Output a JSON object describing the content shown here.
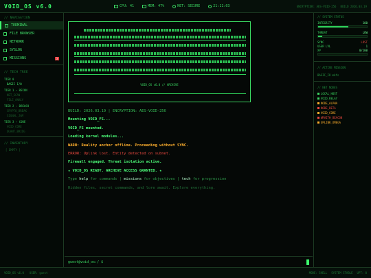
{
  "app": {
    "title": "VOID_OS v6.0"
  },
  "topbar": {
    "cpu": "CPU: 41",
    "mem": "MEM: 47%",
    "net": "NET: SECURE",
    "clock": "21:11:03",
    "right_a": "ENCRYPTION: AES-VOID-256",
    "right_b": "BUILD 2026.03.19"
  },
  "sidebar": {
    "nav_title": "// NAVIGATION",
    "items": [
      {
        "label": "TERMINAL",
        "icon": "terminal-icon"
      },
      {
        "label": "FILE BROWSER",
        "icon": "folder-icon"
      },
      {
        "label": "NETWORK",
        "icon": "network-icon"
      },
      {
        "label": "SYSLOG",
        "icon": "log-icon"
      },
      {
        "label": "MISSIONS",
        "icon": "target-icon",
        "badge": "3"
      }
    ],
    "tech_title": "// TECH TREE",
    "tiers": [
      {
        "label": "TIER 0",
        "items": [
          {
            "label": "BASIC I/O",
            "on": true
          }
        ]
      },
      {
        "label": "TIER 1 - RECON",
        "items": [
          {
            "label": "NET_SCAN",
            "on": false
          },
          {
            "label": "FILE_ANALY",
            "on": false
          }
        ]
      },
      {
        "label": "TIER 2 - BREACH",
        "items": [
          {
            "label": "CRYPTO_BREAK",
            "on": false
          },
          {
            "label": "SIGNAL_JAM",
            "on": false
          }
        ]
      },
      {
        "label": "TIER 3 - CORE",
        "items": [
          {
            "label": "VOID_CORE",
            "on": false
          },
          {
            "label": "QUANT_BRIDG",
            "on": false
          }
        ]
      }
    ],
    "inv_title": "// INVENTORY",
    "inv_empty": "[ EMPTY ]"
  },
  "terminal": {
    "ascii_caption": "VOID_OS v6.0 // ARCHIVE",
    "lines": [
      {
        "cls": "dim",
        "text": "BUILD: 2026.03.19  |  ENCRYPTION: AES-VOID-256"
      },
      {
        "cls": "ok",
        "text": "Mounting VOID_FS..."
      },
      {
        "cls": "ok",
        "text": "VOID_FS mounted."
      },
      {
        "cls": "ok",
        "text": "Loading kernel modules..."
      },
      {
        "cls": "warn",
        "text": "WARN: Reality anchor offline. Proceeding without SYNC."
      },
      {
        "cls": "err",
        "text": "ERROR: Uplink lost. Entity detected on subnet."
      },
      {
        "cls": "ok",
        "text": "Firewall engaged. Threat isolation active."
      },
      {
        "cls": "ok",
        "text": "★ VOID_OS READY. ARCHIVE ACCESS GRANTED. ★"
      }
    ],
    "help": {
      "a": "Type ",
      "b": "help",
      "c": " for commands  |  ",
      "d": "missions",
      "e": " for objectives  |  ",
      "f": "tech",
      "g": " for progression"
    },
    "hint": "Hidden files, secret commands, and lore await. Explore everything.",
    "prompt": "guest@void_os:/ $",
    "input_value": ""
  },
  "right": {
    "status_title": "// SYSTEM STATUS",
    "metrics": [
      {
        "label": "INTEGRITY",
        "value": "100",
        "fill": 0.62
      },
      {
        "label": "THREAT",
        "value": "LOW",
        "fill": 0.08
      }
    ],
    "rows": [
      {
        "label": "SYNC",
        "value": "LOST",
        "red": true
      },
      {
        "label": "USER LVL",
        "value": "1",
        "red": false
      },
      {
        "label": "XP",
        "value": "0/100",
        "red": false
      }
    ],
    "mission_title": "// ACTIVE MISSION",
    "mission": "BASIC_IO mkfs",
    "nodes_title": "// NET NODES",
    "nodes": [
      {
        "label": "LOCAL_HOST",
        "kind": "g"
      },
      {
        "label": "VOID_RELAY",
        "kind": "g"
      },
      {
        "label": "NODE_ALPHA",
        "kind": "w"
      },
      {
        "label": "NODE_BETA",
        "kind": "r"
      },
      {
        "label": "VOID_CORE",
        "kind": "w"
      },
      {
        "label": "WRAITH_BEACON",
        "kind": "r"
      },
      {
        "label": "UPLINK_OMEGA",
        "kind": "w"
      }
    ]
  },
  "status": {
    "left_a": "VOID_OS v6.0",
    "left_b": "USER: guest",
    "right_a": "MODE: SHELL",
    "right_b": "SYSTEM STABLE",
    "right_c": "UPT: 0"
  }
}
